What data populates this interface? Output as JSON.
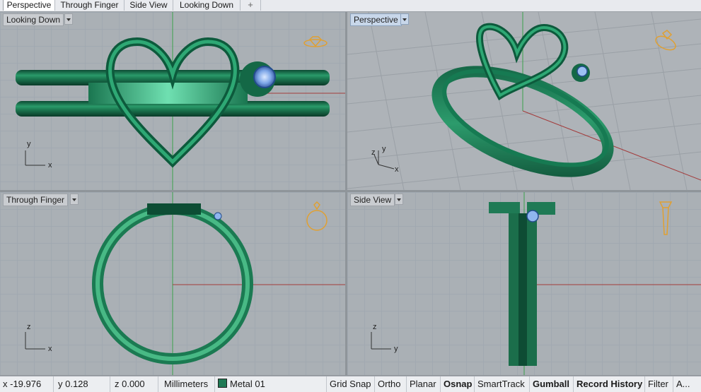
{
  "tabs": [
    "Perspective",
    "Through Finger",
    "Side View",
    "Looking Down",
    "+"
  ],
  "viewports": {
    "top_left": {
      "label": "Looking Down",
      "axis_x": "x",
      "axis_y": "y"
    },
    "top_right": {
      "label": "Perspective",
      "axis_x": "x",
      "axis_y": "y",
      "axis_z": "z"
    },
    "bottom_left": {
      "label": "Through Finger",
      "axis_x": "x",
      "axis_z": "z"
    },
    "bottom_right": {
      "label": "Side View",
      "axis_y": "y",
      "axis_z": "z"
    }
  },
  "status": {
    "x": "x -19.976",
    "y": "y 0.128",
    "z": "z 0.000",
    "units": "Millimeters",
    "layer": "Metal 01",
    "toggles": [
      "Grid Snap",
      "Ortho",
      "Planar",
      "Osnap",
      "SmartTrack",
      "Gumball",
      "Record History",
      "Filter",
      "A..."
    ]
  },
  "colors": {
    "metal": "#1f7a55",
    "gem": "#8fb6ee",
    "active_viewport": "#c8d7ea"
  },
  "icons": {
    "top_left": "ring-top-icon",
    "top_right": "ring-perspective-icon",
    "bottom_left": "ring-front-icon",
    "bottom_right": "ring-side-icon"
  }
}
